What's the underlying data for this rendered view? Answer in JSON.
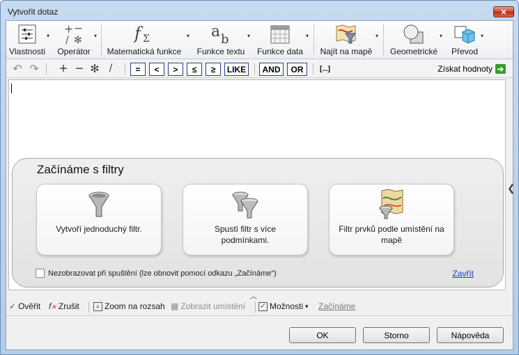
{
  "window": {
    "title": "Vytvořit dotaz",
    "close_glyph": "✕"
  },
  "ribbon": {
    "buttons": [
      {
        "label": "Vlastnosti",
        "icon": "properties-icon"
      },
      {
        "label": "Operátor",
        "icon": "operator-icon"
      },
      {
        "label": "Matematická funkce",
        "icon": "math-function-icon"
      },
      {
        "label": "Funkce textu",
        "icon": "text-function-icon"
      },
      {
        "label": "Funkce data",
        "icon": "date-function-icon"
      },
      {
        "label": "Najít na mapě",
        "icon": "find-on-map-icon"
      },
      {
        "label": "Geometrické",
        "icon": "geometry-icon"
      },
      {
        "label": "Převod",
        "icon": "conversion-icon"
      }
    ],
    "dropdown_glyph": "▾"
  },
  "expression_toolbar": {
    "undo": "↶",
    "redo": "↷",
    "plus": "+",
    "minus": "−",
    "multiply": "✻",
    "divide": "/",
    "operators": [
      "=",
      "<",
      ">",
      "≤",
      "≥",
      "LIKE"
    ],
    "logic": [
      "AND",
      "OR"
    ],
    "ellipsis": "[...]",
    "get_values": "Získat hodnoty",
    "get_values_arrow": "➔"
  },
  "getting_started": {
    "title": "Začínáme s filtry",
    "cards": [
      {
        "text": "Vytvoří jednoduchý filtr.",
        "icon": "funnel-icon"
      },
      {
        "text": "Spustí filtr s více podmínkami.",
        "icon": "multi-funnel-icon"
      },
      {
        "text": "Filtr prvků podle umístění na mapě",
        "icon": "map-filter-icon"
      }
    ],
    "dont_show": "Nezobrazovat při spuštění (lze obnovit pomocí odkazu „Začínáme“)",
    "close_link": "Zavřít"
  },
  "bottom_toolbar": {
    "verify": "Ověřit",
    "cancel": "Zrušit",
    "zoom": "Zoom na rozsah",
    "show_location": "Zobrazit umístění",
    "options": "Možnosti",
    "getting_started": "Začínáme"
  },
  "dialog_buttons": {
    "ok": "OK",
    "cancel": "Storno",
    "help": "Nápověda"
  },
  "colors": {
    "accent_blue": "#1a3ec8",
    "close_red": "#c9452f",
    "go_green": "#3a9b2c"
  }
}
